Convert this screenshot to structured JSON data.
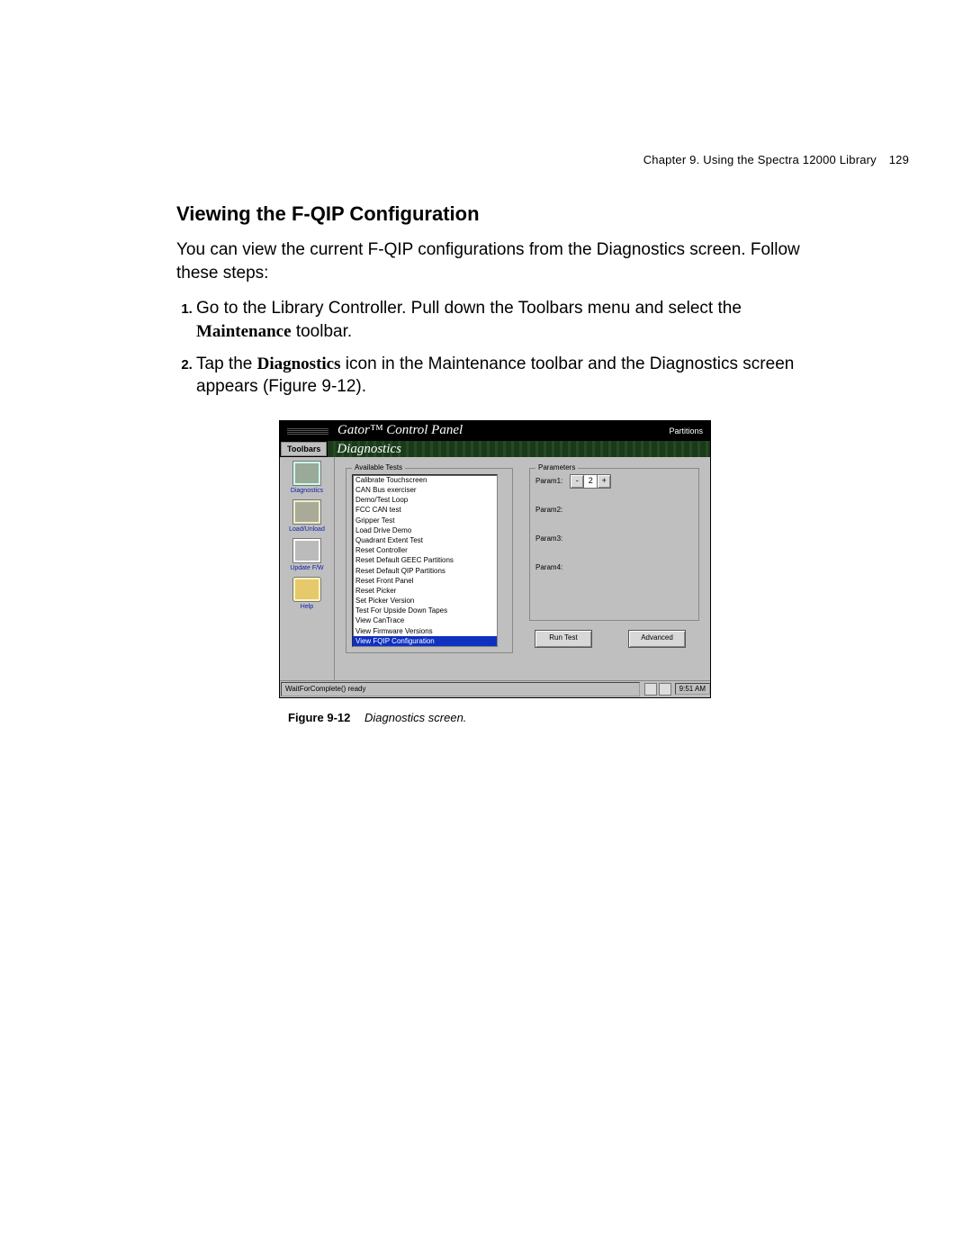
{
  "header": {
    "chapter": "Chapter 9. Using the Spectra 12000 Library",
    "page": "129"
  },
  "section": {
    "title": "Viewing the F-QIP Configuration",
    "intro": "You can view the current F-QIP configurations from the Diagnostics screen. Follow these steps:",
    "steps": [
      {
        "pre": "Go to the Library Controller. Pull down the Toolbars menu and select the ",
        "kw": "Maintenance",
        "post": " toolbar."
      },
      {
        "pre": "Tap the ",
        "kw": "Diagnostics",
        "post": " icon in the Maintenance toolbar and the Diagnostics screen appears (Figure 9-12)."
      }
    ]
  },
  "screenshot": {
    "titlebar": {
      "brand": "Gator™ Control Panel",
      "partitions": "Partitions"
    },
    "menubar": {
      "toolbars": "Toolbars",
      "screen_label": "Diagnostics"
    },
    "sidebar": [
      {
        "label": "Diagnostics"
      },
      {
        "label": "Load/Unload"
      },
      {
        "label": "Update F/W"
      },
      {
        "label": "Help"
      }
    ],
    "tests": {
      "legend": "Available Tests",
      "items": [
        "Calibrate Touchscreen",
        "CAN Bus exerciser",
        "Demo/Test Loop",
        "FCC CAN test",
        "Gripper Test",
        "Load Drive Demo",
        "Quadrant Extent Test",
        "Reset Controller",
        "Reset Default GEEC Partitions",
        "Reset Default QIP Partitions",
        "Reset Front Panel",
        "Reset Picker",
        "Set Picker Version",
        "Test For Upside Down Tapes",
        "View CanTrace",
        "View Firmware Versions",
        "View FQIP Configuration"
      ],
      "selected_index": 16
    },
    "params": {
      "legend": "Parameters",
      "rows": [
        "Param1:",
        "Param2:",
        "Param3:",
        "Param4:"
      ],
      "spinner": {
        "minus": "-",
        "value": "2",
        "plus": "+"
      }
    },
    "buttons": {
      "run": "Run Test",
      "advanced": "Advanced"
    },
    "status": {
      "msg": "WaitForComplete() ready",
      "clock": "9:51 AM"
    }
  },
  "figure": {
    "num": "Figure 9-12",
    "caption": "Diagnostics screen."
  }
}
